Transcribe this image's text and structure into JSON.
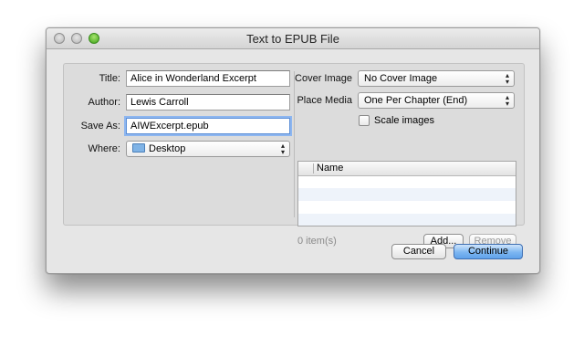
{
  "window": {
    "title": "Text to EPUB File"
  },
  "left": {
    "title_label": "Title:",
    "title_value": "Alice in Wonderland Excerpt",
    "author_label": "Author:",
    "author_value": "Lewis Carroll",
    "saveas_label": "Save As:",
    "saveas_value": "AIWExcerpt.epub",
    "where_label": "Where:",
    "where_value": "Desktop"
  },
  "right": {
    "cover_label": "Cover Image",
    "cover_value": "No Cover Image",
    "place_label": "Place Media",
    "place_value": "One Per Chapter (End)",
    "scale_label": "Scale images",
    "scale_checked": false,
    "table_column": "Name",
    "items_count": "0 item(s)",
    "add_label": "Add...",
    "remove_label": "Remove"
  },
  "footer": {
    "cancel_label": "Cancel",
    "continue_label": "Continue"
  },
  "icons": {
    "window_close": "close-icon",
    "window_minimize": "minimize-icon",
    "window_zoom": "zoom-icon",
    "folder": "folder-icon",
    "popup_arrows": "up-down-arrows-icon"
  },
  "colors": {
    "default_button": "#6aa9ee",
    "focus_ring": "#8db6f0",
    "zoom_button": "#3ea419"
  }
}
